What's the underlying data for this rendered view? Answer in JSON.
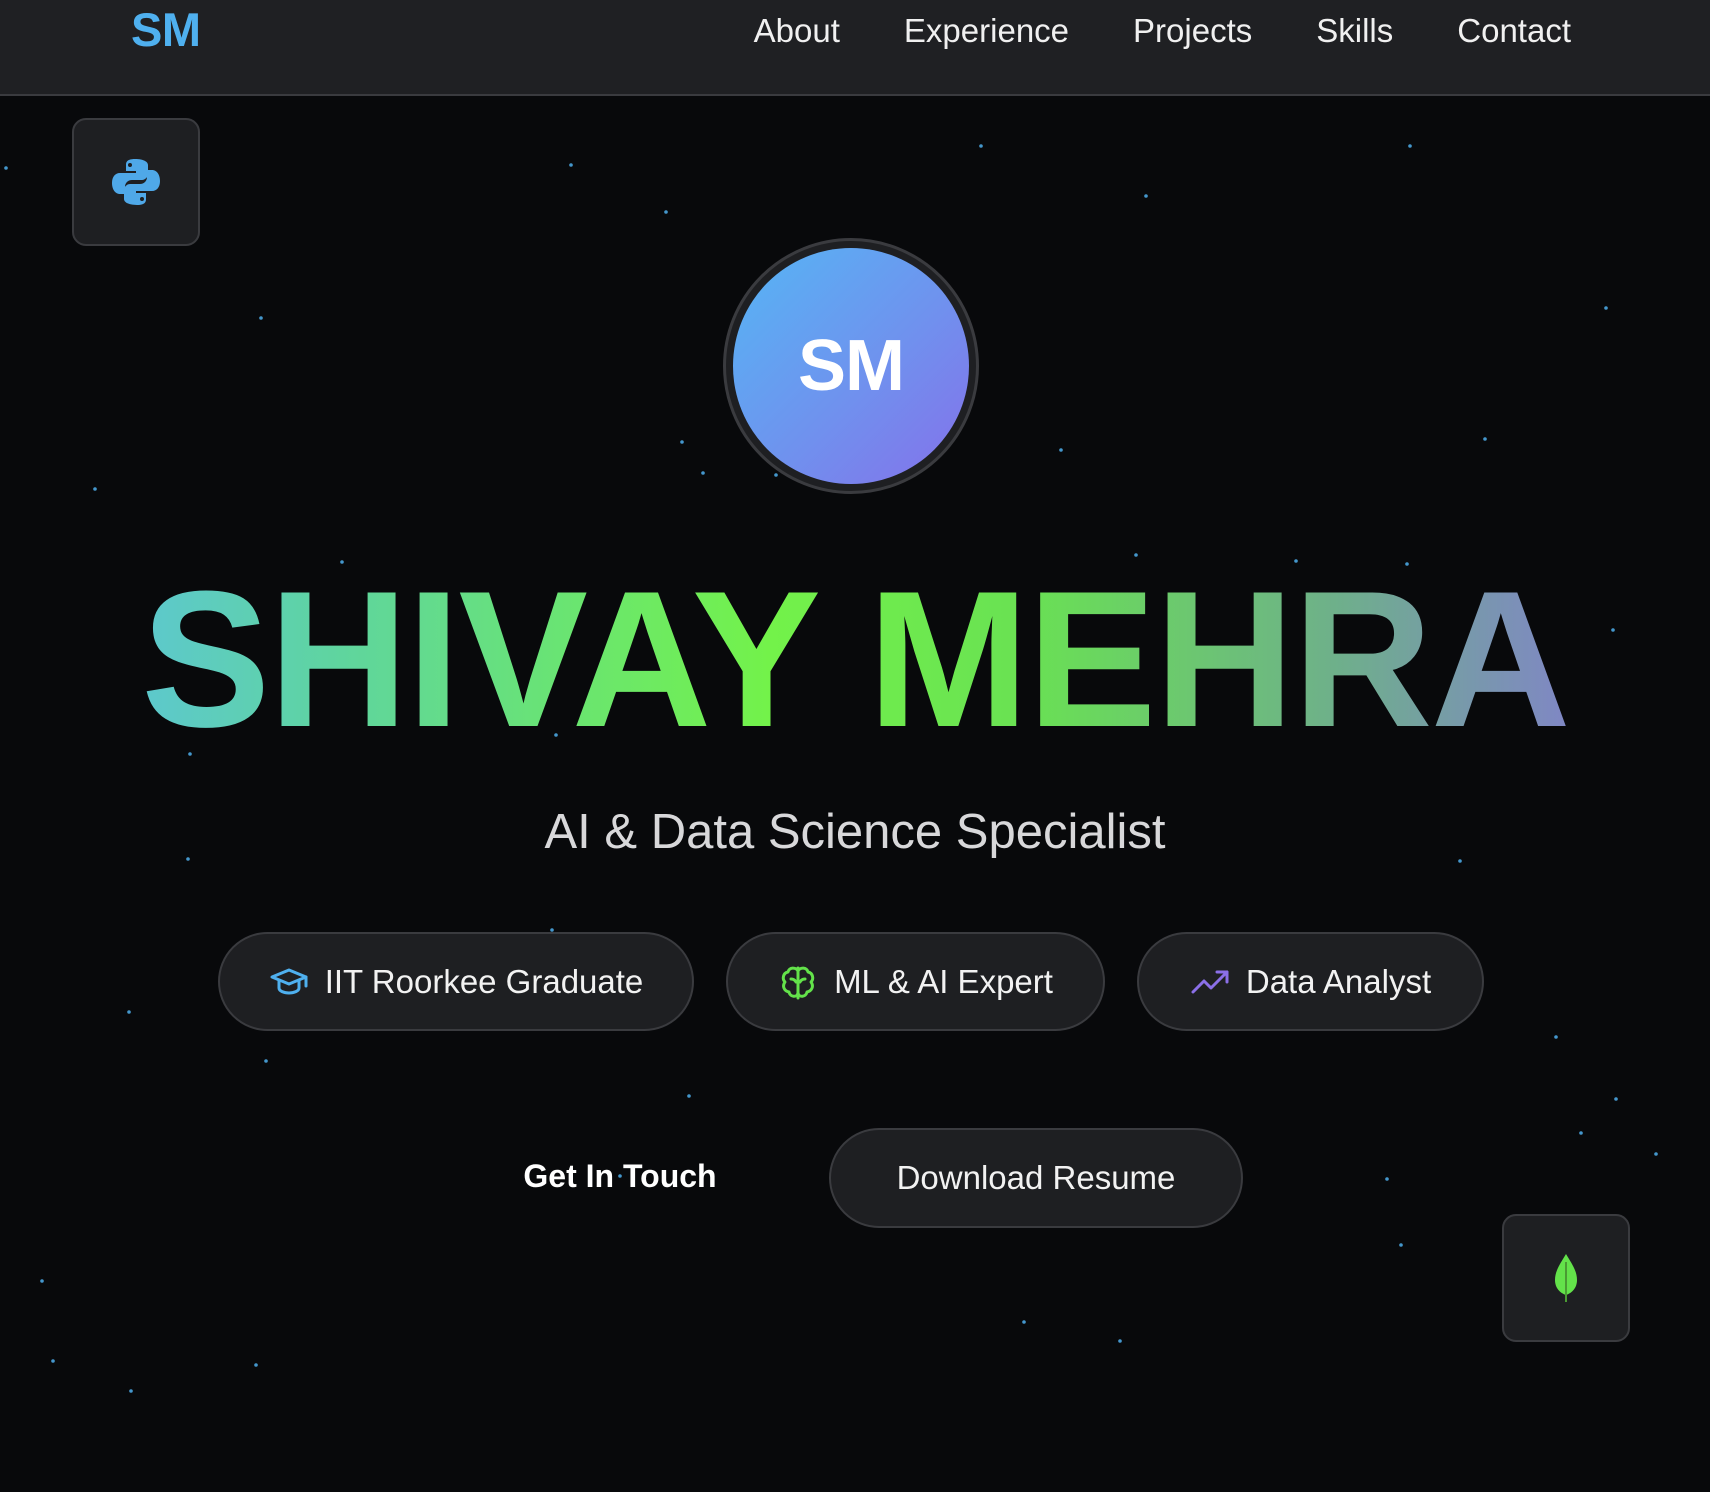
{
  "header": {
    "logo": "SM",
    "nav": [
      "About",
      "Experience",
      "Projects",
      "Skills",
      "Contact"
    ]
  },
  "floating_icons": [
    "python-icon",
    "mongodb-leaf-icon"
  ],
  "hero": {
    "avatar_initials": "SM",
    "name": "SHIVAY MEHRA",
    "subtitle": "AI & Data Science Specialist",
    "badges": [
      {
        "icon": "graduation-cap-icon",
        "label": "IIT Roorkee Graduate",
        "color": "#4fb0ef"
      },
      {
        "icon": "brain-icon",
        "label": "ML & AI Expert",
        "color": "#63e24a"
      },
      {
        "icon": "trending-up-icon",
        "label": "Data Analyst",
        "color": "#8b6fe8"
      }
    ],
    "cta_primary": "Get In Touch",
    "cta_secondary": "Download Resume"
  },
  "colors": {
    "background": "#08090b",
    "header": "#1f2023",
    "accent_blue": "#4fb0ef",
    "accent_green": "#73f24a",
    "accent_purple": "#8b6fe8"
  }
}
